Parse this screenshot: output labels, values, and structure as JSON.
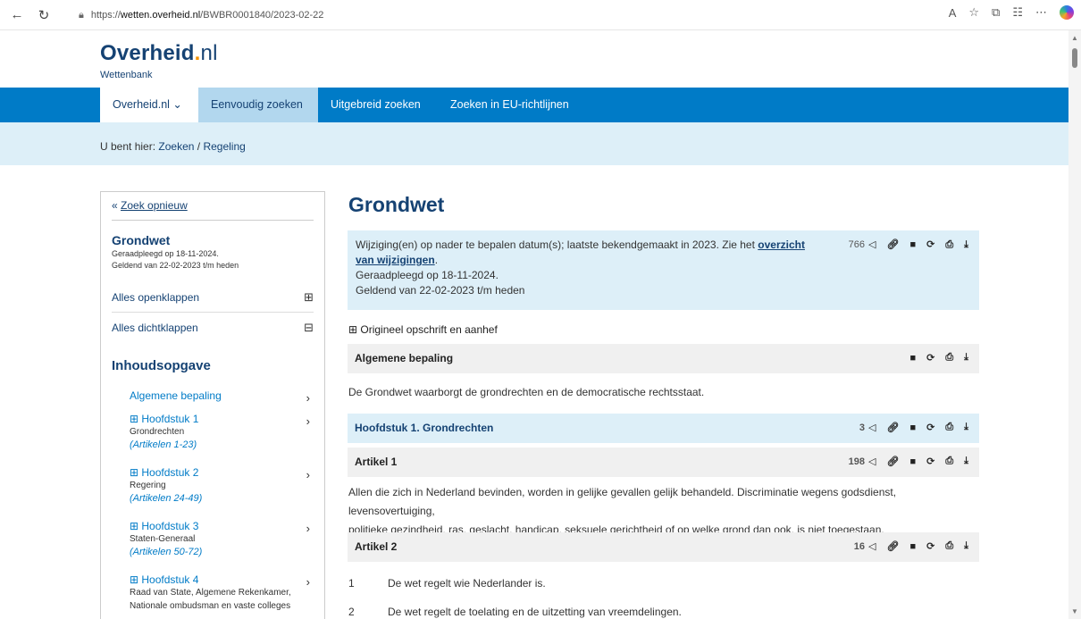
{
  "browser": {
    "url_prefix": "https://",
    "url_host": "wetten.overheid.nl",
    "url_path": "/BWBR0001840/2023-02-22"
  },
  "site": {
    "logo_main": "Overheid",
    "logo_tld": "nl",
    "logo_sub": "Wettenbank"
  },
  "nav": {
    "home": "Overheid.nl",
    "simple_search": "Eenvoudig zoeken",
    "advanced_search": "Uitgebreid zoeken",
    "eu_search": "Zoeken in EU-richtlijnen"
  },
  "breadcrumb": {
    "prefix": "U bent hier:",
    "search": "Zoeken",
    "sep": "/",
    "current": "Regeling"
  },
  "sidebar": {
    "search_again": "Zoek opnieuw",
    "title": "Grondwet",
    "consulted": "Geraadpleegd op 18-11-2024.",
    "valid": "Geldend van 22-02-2023 t/m heden",
    "expand_all": "Alles openklappen",
    "collapse_all": "Alles dichtklappen",
    "toc_heading": "Inhoudsopgave",
    "toc": [
      {
        "label": "Algemene bepaling",
        "sub": "",
        "range": ""
      },
      {
        "label": "⊞ Hoofdstuk 1",
        "sub": "Grondrechten",
        "range": "(Artikelen 1-23)"
      },
      {
        "label": "⊞ Hoofdstuk 2",
        "sub": "Regering",
        "range": "(Artikelen 24-49)"
      },
      {
        "label": "⊞ Hoofdstuk 3",
        "sub": "Staten-Generaal",
        "range": "(Artikelen 50-72)"
      },
      {
        "label": "⊞ Hoofdstuk 4",
        "sub": "Raad van State, Algemene Rekenkamer,",
        "range": "Nationale ombudsman en vaste colleges"
      }
    ]
  },
  "content": {
    "title": "Grondwet",
    "notice_text": "Wijziging(en) op nader te bepalen datum(s); laatste bekendgemaakt in 2023. Zie het ",
    "notice_link": "overzicht van wijzigingen",
    "notice_end": ".",
    "notice_consulted": "Geraadpleegd op 18-11-2024.",
    "notice_valid": "Geldend van 22-02-2023 t/m heden",
    "notice_count": "766",
    "original": "⊞ Origineel opschrift en aanhef",
    "general_heading": "Algemene bepaling",
    "general_text": "De Grondwet waarborgt de grondrechten en de democratische rechtsstaat.",
    "chapter1": "Hoofdstuk 1. Grondrechten",
    "chapter1_count": "3",
    "art1": "Artikel 1",
    "art1_count": "198",
    "art1_text_1": "Allen die zich in Nederland bevinden, worden in gelijke gevallen gelijk behandeld. Discriminatie wegens godsdienst, levensovertuiging,",
    "art1_text_2": "politieke gezindheid, ras, geslacht, handicap, seksuele gerichtheid of op welke grond dan ook, is niet toegestaan.",
    "art2": "Artikel 2",
    "art2_count": "16",
    "art2_items": [
      {
        "n": "1",
        "text": "De wet regelt wie Nederlander is."
      },
      {
        "n": "2",
        "text": "De wet regelt de toelating en de uitzetting van vreemdelingen."
      }
    ]
  },
  "icons": {
    "share": "share-icon",
    "link": "link-icon",
    "info": "info-icon",
    "refresh": "timeline-icon",
    "print": "print-icon",
    "download": "download-icon"
  }
}
